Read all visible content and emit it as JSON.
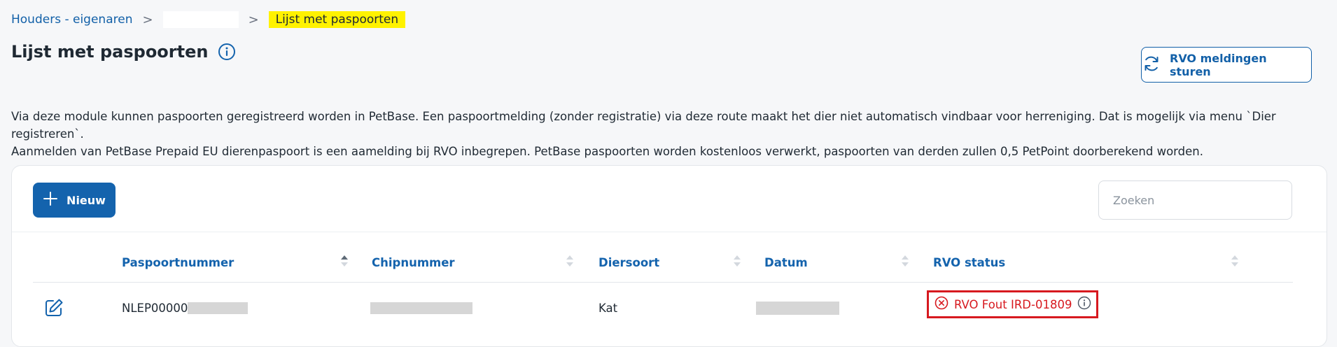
{
  "breadcrumb": {
    "items": [
      {
        "label": "Houders - eigenaren"
      },
      {
        "label": ""
      },
      {
        "label": "Lijst met paspoorten"
      }
    ],
    "separator": ">"
  },
  "header": {
    "title": "Lijst met paspoorten",
    "rvo_button_label": "RVO meldingen sturen"
  },
  "description": {
    "line1": "Via deze module kunnen paspoorten geregistreerd worden in PetBase. Een paspoortmelding (zonder registratie) via deze route maakt het dier niet automatisch vindbaar voor herreniging. Dat is mogelijk via menu `Dier registreren`.",
    "line2": "Aanmelden van PetBase Prepaid EU dierenpaspoort is een aamelding bij RVO inbegrepen. PetBase paspoorten worden kostenloos verwerkt, paspoorten van derden zullen 0,5 PetPoint doorberekend worden."
  },
  "toolbar": {
    "new_label": "Nieuw",
    "search_placeholder": "Zoeken",
    "search_value": ""
  },
  "table": {
    "columns": [
      {
        "label": "Paspoortnummer",
        "sort": "ascending"
      },
      {
        "label": "Chipnummer",
        "sort": "none"
      },
      {
        "label": "Diersoort",
        "sort": "none"
      },
      {
        "label": "Datum",
        "sort": "none"
      },
      {
        "label": "RVO status",
        "sort": "none"
      }
    ],
    "rows": [
      {
        "paspoortnummer": "NLEP00000",
        "chipnummer": "",
        "diersoort": "Kat",
        "datum": "",
        "rvo_status": "RVO Fout IRD-01809"
      }
    ]
  },
  "colors": {
    "accent": "#1463ad",
    "link": "#1260a8",
    "highlight": "#fff200",
    "error": "#d7191f",
    "background": "#f6f7f9"
  },
  "icons": {
    "title_info": "info-icon",
    "rvo_button": "refresh-icon",
    "new_button": "plus-icon",
    "row_edit": "edit-icon",
    "status_error": "error-circle-icon",
    "status_info": "info-icon"
  }
}
